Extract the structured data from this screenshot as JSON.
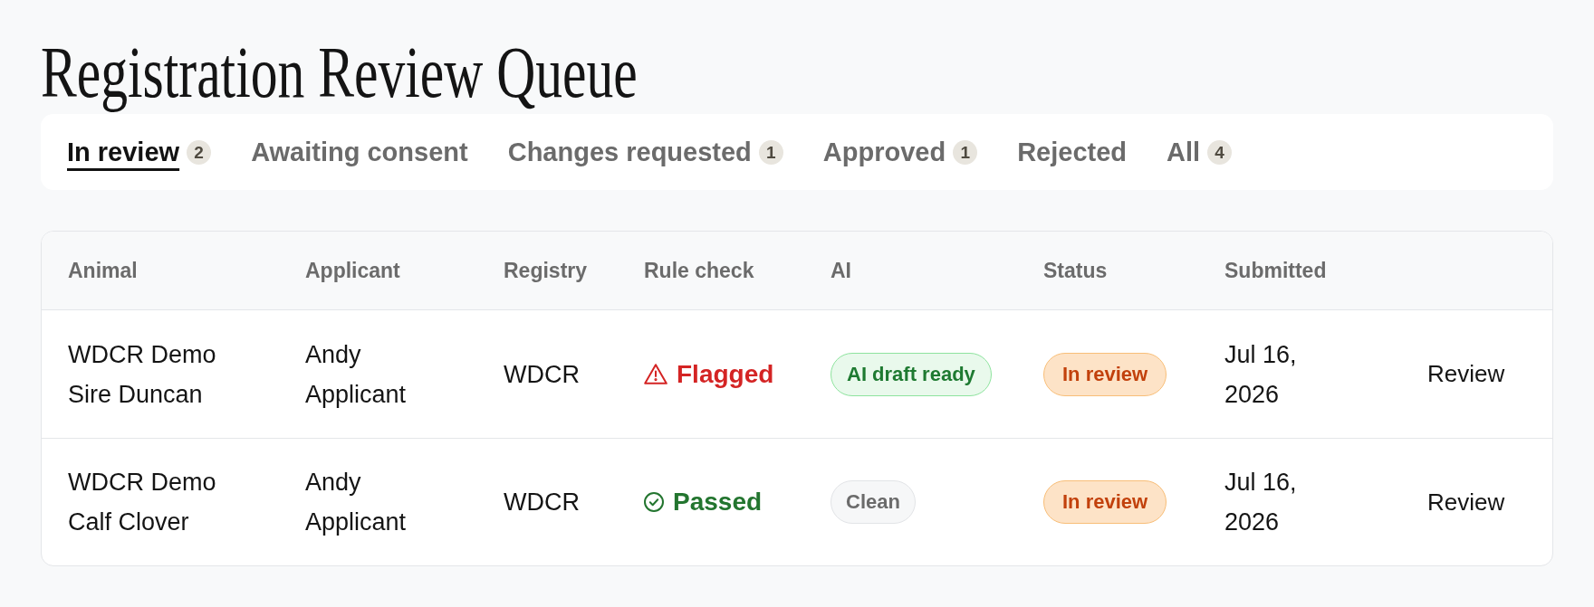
{
  "page": {
    "title": "Registration Review Queue"
  },
  "tabs": [
    {
      "label": "In review",
      "count": "2",
      "selected": true
    },
    {
      "label": "Awaiting consent",
      "selected": false
    },
    {
      "label": "Changes requested",
      "count": "1",
      "selected": false
    },
    {
      "label": "Approved",
      "count": "1",
      "selected": false
    },
    {
      "label": "Rejected",
      "selected": false
    },
    {
      "label": "All",
      "count": "4",
      "selected": false
    }
  ],
  "table": {
    "columns": [
      "Animal",
      "Applicant",
      "Registry",
      "Rule check",
      "AI",
      "Status",
      "Submitted"
    ],
    "rows": [
      {
        "animal": "WDCR Demo Sire Duncan",
        "applicant": "Andy Applicant",
        "registry": "WDCR",
        "rule_check": {
          "kind": "flagged",
          "label": "Flagged"
        },
        "ai": {
          "kind": "draft",
          "label": "AI draft ready"
        },
        "status": {
          "kind": "in_review",
          "label": "In review"
        },
        "submitted": "Jul 16, 2026",
        "action": "Review"
      },
      {
        "animal": "WDCR Demo Calf Clover",
        "applicant": "Andy Applicant",
        "registry": "WDCR",
        "rule_check": {
          "kind": "passed",
          "label": "Passed"
        },
        "ai": {
          "kind": "clean",
          "label": "Clean"
        },
        "status": {
          "kind": "in_review",
          "label": "In review"
        },
        "submitted": "Jul 16, 2026",
        "action": "Review"
      }
    ]
  }
}
